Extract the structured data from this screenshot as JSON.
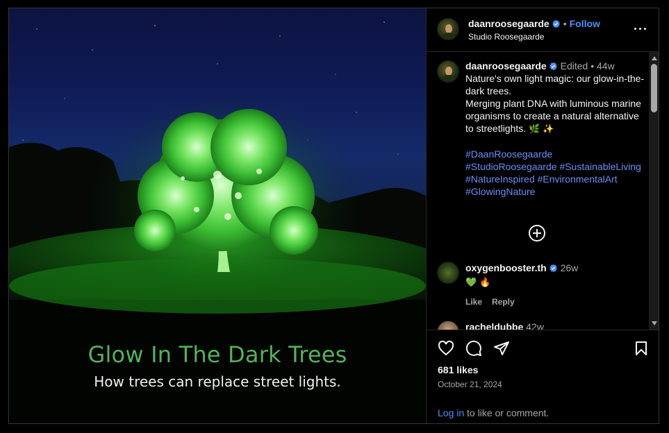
{
  "media": {
    "title": "Glow In The Dark Trees",
    "subtitle": "How trees can replace street lights."
  },
  "header": {
    "username": "daanroosegaarde",
    "separator": "•",
    "follow_label": "Follow",
    "subtitle": "Studio Roosegaarde",
    "more_icon": "more-horizontal-icon"
  },
  "caption": {
    "username": "daanroosegaarde",
    "edited": "Edited",
    "separator": "•",
    "time": "44w",
    "line1": "Nature's own light magic: our glow-in-the-dark trees.",
    "line2": "Merging plant DNA with luminous marine organisms to create a natural alternative to streetlights.",
    "emoji1": "🌿",
    "emoji2": "✨",
    "hashtags": [
      "#DaanRoosegaarde",
      "#StudioRoosegaarde",
      "#SustainableLiving",
      "#NatureInspired",
      "#EnvironmentalArt",
      "#GlowingNature"
    ]
  },
  "comments": [
    {
      "username": "oxygenbooster.th",
      "verified": true,
      "time": "26w",
      "text_emojis": [
        "💚",
        "🔥"
      ],
      "like_label": "Like",
      "reply_label": "Reply"
    },
    {
      "username": "racheldubbe",
      "verified": false,
      "time": "42w"
    }
  ],
  "actions": {
    "like_icon": "heart-icon",
    "comment_icon": "comment-icon",
    "share_icon": "paper-plane-icon",
    "save_icon": "bookmark-icon",
    "likes": "681 likes",
    "date": "October 21, 2024",
    "login_link": "Log in",
    "login_rest": " to like or comment."
  },
  "colors": {
    "accent": "#4f8ff7",
    "hashtag": "#6c8ff5",
    "verified": "#4f8ff7",
    "glow_green": "#55b15a"
  }
}
